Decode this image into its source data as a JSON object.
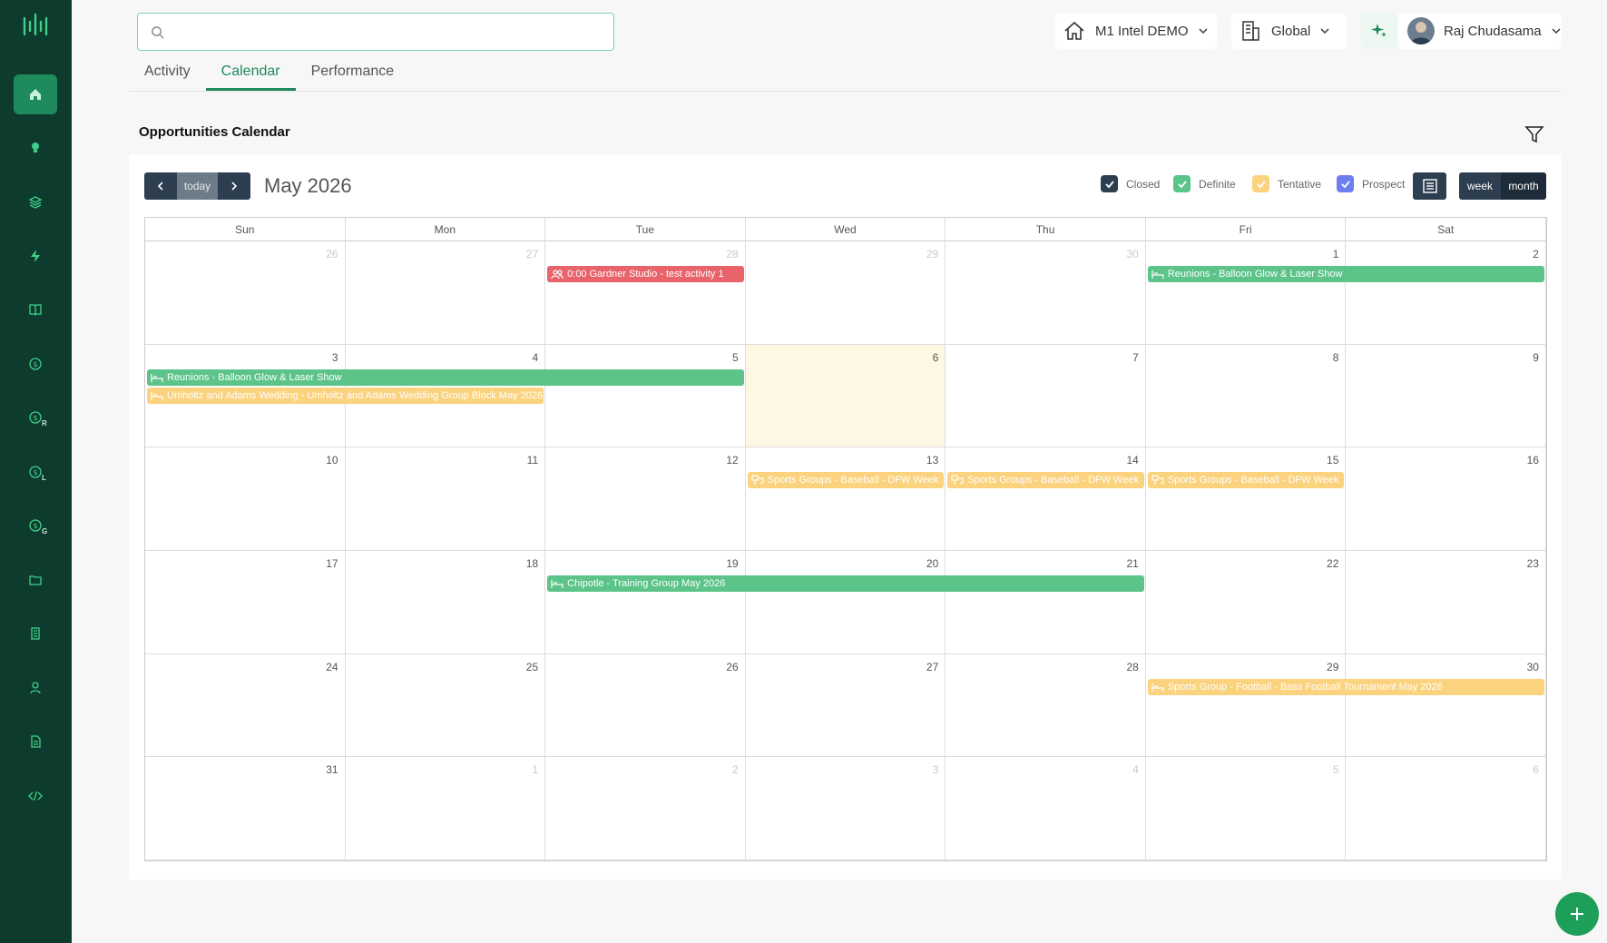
{
  "search": {
    "placeholder": ""
  },
  "tabs": [
    {
      "label": "Activity"
    },
    {
      "label": "Calendar"
    },
    {
      "label": "Performance"
    }
  ],
  "header": {
    "org": "M1 Intel DEMO",
    "scope": "Global",
    "user": "Raj Chudasama"
  },
  "section": {
    "title": "Opportunities Calendar"
  },
  "calendar": {
    "today_label": "today",
    "title": "May 2026",
    "legend": [
      {
        "label": "Closed",
        "color": "#2c3e50"
      },
      {
        "label": "Definite",
        "color": "#5cc389"
      },
      {
        "label": "Tentative",
        "color": "#fbd27e"
      },
      {
        "label": "Prospect",
        "color": "#6c7ef0"
      }
    ],
    "views": {
      "week": "week",
      "month": "month"
    },
    "weekdays": [
      "Sun",
      "Mon",
      "Tue",
      "Wed",
      "Thu",
      "Fri",
      "Sat"
    ],
    "weeks": [
      [
        {
          "d": "26",
          "o": true
        },
        {
          "d": "27",
          "o": true
        },
        {
          "d": "28",
          "o": true
        },
        {
          "d": "29",
          "o": true
        },
        {
          "d": "30",
          "o": true
        },
        {
          "d": "1"
        },
        {
          "d": "2"
        }
      ],
      [
        {
          "d": "3"
        },
        {
          "d": "4"
        },
        {
          "d": "5"
        },
        {
          "d": "6",
          "today": true
        },
        {
          "d": "7"
        },
        {
          "d": "8"
        },
        {
          "d": "9"
        }
      ],
      [
        {
          "d": "10"
        },
        {
          "d": "11"
        },
        {
          "d": "12"
        },
        {
          "d": "13"
        },
        {
          "d": "14"
        },
        {
          "d": "15"
        },
        {
          "d": "16"
        }
      ],
      [
        {
          "d": "17"
        },
        {
          "d": "18"
        },
        {
          "d": "19"
        },
        {
          "d": "20"
        },
        {
          "d": "21"
        },
        {
          "d": "22"
        },
        {
          "d": "23"
        }
      ],
      [
        {
          "d": "24"
        },
        {
          "d": "25"
        },
        {
          "d": "26"
        },
        {
          "d": "27"
        },
        {
          "d": "28"
        },
        {
          "d": "29"
        },
        {
          "d": "30"
        }
      ],
      [
        {
          "d": "31"
        },
        {
          "d": "1",
          "o": true
        },
        {
          "d": "2",
          "o": true
        },
        {
          "d": "3",
          "o": true
        },
        {
          "d": "4",
          "o": true
        },
        {
          "d": "5",
          "o": true
        },
        {
          "d": "6",
          "o": true
        }
      ]
    ],
    "events": [
      {
        "week": 0,
        "start": 2,
        "span": 1,
        "slot": 0,
        "color": "red",
        "icon": "people",
        "title": "0:00 Gardner Studio - test activity 1"
      },
      {
        "week": 0,
        "start": 5,
        "span": 2,
        "slot": 0,
        "color": "green",
        "icon": "bed",
        "title": "Reunions - Balloon Glow & Laser Show"
      },
      {
        "week": 1,
        "start": 0,
        "span": 3,
        "slot": 0,
        "color": "green",
        "icon": "bed",
        "title": "Reunions - Balloon Glow & Laser Show"
      },
      {
        "week": 1,
        "start": 0,
        "span": 2,
        "slot": 1,
        "color": "yellow",
        "icon": "bed",
        "title": "Umholtz and Adams Wedding - Umholtz and Adams Wedding Group Block May 2026"
      },
      {
        "week": 2,
        "start": 3,
        "span": 1,
        "slot": 0,
        "color": "yellow",
        "icon": "meeting",
        "title": "Sports Groups - Baseball - DFW Week"
      },
      {
        "week": 2,
        "start": 4,
        "span": 1,
        "slot": 0,
        "color": "yellow",
        "icon": "meeting",
        "title": "Sports Groups - Baseball - DFW Week"
      },
      {
        "week": 2,
        "start": 5,
        "span": 1,
        "slot": 0,
        "color": "yellow",
        "icon": "meeting",
        "title": "Sports Groups - Baseball - DFW Week"
      },
      {
        "week": 3,
        "start": 2,
        "span": 3,
        "slot": 0,
        "color": "green",
        "icon": "bed",
        "title": "Chipotle - Training Group May 2026"
      },
      {
        "week": 4,
        "start": 5,
        "span": 2,
        "slot": 0,
        "color": "yellow",
        "icon": "bed",
        "title": "Sports Group - Football - Bass Football Tournament May 2026"
      }
    ]
  }
}
